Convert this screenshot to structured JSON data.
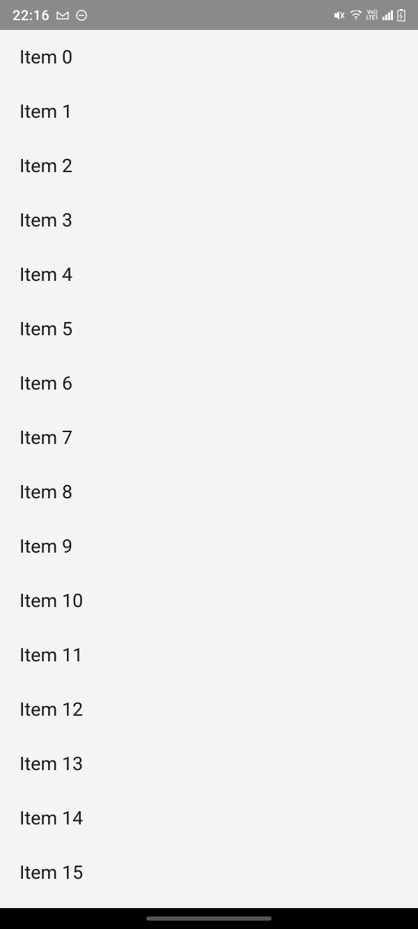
{
  "status_bar": {
    "time": "22:16",
    "icons": {
      "gmail": "M",
      "dnd": "⊖",
      "mute": "🔇",
      "wifi": "📶",
      "volte_top": "Vo))",
      "volte_bottom": "LTE1",
      "battery": "🔋"
    }
  },
  "list": {
    "items": [
      "Item 0",
      "Item 1",
      "Item 2",
      "Item 3",
      "Item 4",
      "Item 5",
      "Item 6",
      "Item 7",
      "Item 8",
      "Item 9",
      "Item 10",
      "Item 11",
      "Item 12",
      "Item 13",
      "Item 14",
      "Item 15"
    ]
  }
}
